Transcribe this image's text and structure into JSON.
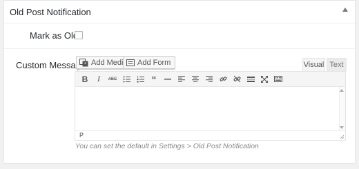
{
  "metabox": {
    "title": "Old Post Notification"
  },
  "fields": {
    "mark_old_label": "Mark as Old",
    "mark_old_checked": false,
    "custom_message_label": "Custom Message"
  },
  "editor": {
    "add_media_label": "Add Media",
    "add_form_label": "Add Form",
    "tabs": {
      "visual": "Visual",
      "text": "Text"
    },
    "active_tab": "Visual",
    "toolbar_buttons": [
      "bold-icon",
      "italic-icon",
      "strikethrough-icon",
      "bullet-list-icon",
      "numbered-list-icon",
      "blockquote-icon",
      "horizontal-line-icon",
      "align-left-icon",
      "align-center-icon",
      "align-right-icon",
      "insert-link-icon",
      "remove-link-icon",
      "read-more-icon",
      "fullscreen-icon",
      "toolbar-toggle-icon"
    ],
    "strike_label": "ABC",
    "status_path": "P",
    "content": ""
  },
  "help_text": "You can set the default in Settings > Old Post Notification"
}
